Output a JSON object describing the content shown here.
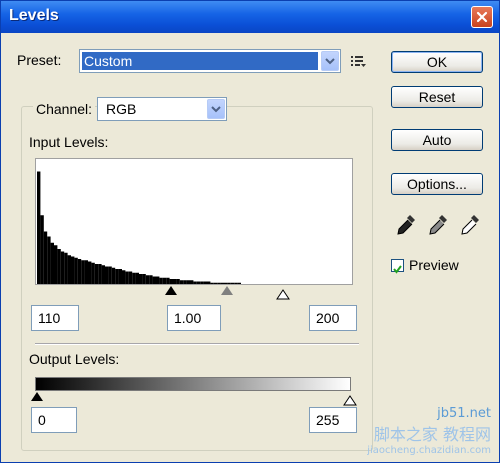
{
  "window": {
    "title": "Levels"
  },
  "preset": {
    "label": "Preset:",
    "value": "Custom"
  },
  "channel": {
    "label": "Channel:",
    "value": "RGB"
  },
  "input_levels": {
    "label": "Input Levels:",
    "black": "110",
    "gamma": "1.00",
    "white": "200",
    "histogram": [
      0.9,
      0.55,
      0.42,
      0.38,
      0.33,
      0.31,
      0.28,
      0.26,
      0.25,
      0.23,
      0.22,
      0.21,
      0.2,
      0.19,
      0.19,
      0.18,
      0.17,
      0.16,
      0.16,
      0.15,
      0.14,
      0.14,
      0.13,
      0.12,
      0.12,
      0.11,
      0.1,
      0.1,
      0.09,
      0.09,
      0.08,
      0.08,
      0.07,
      0.07,
      0.06,
      0.06,
      0.05,
      0.05,
      0.05,
      0.04,
      0.04,
      0.04,
      0.03,
      0.03,
      0.03,
      0.03,
      0.02,
      0.02,
      0.02,
      0.02,
      0.02,
      0.01,
      0.01,
      0.01,
      0.01,
      0.01,
      0.01,
      0.01,
      0.01,
      0.01
    ]
  },
  "output_levels": {
    "label": "Output Levels:",
    "black": "0",
    "white": "255"
  },
  "buttons": {
    "ok": "OK",
    "reset": "Reset",
    "auto": "Auto",
    "options": "Options..."
  },
  "preview": {
    "label": "Preview",
    "checked": true
  },
  "watermark": {
    "line1": "jb51.net",
    "line2": "脚本之家 教程网",
    "line3": "jiaocheng.chazidian.com"
  },
  "colors": {
    "title_bar": "#0b4fd6",
    "dialog_bg": "#ece9d8",
    "selection": "#316ac5"
  }
}
